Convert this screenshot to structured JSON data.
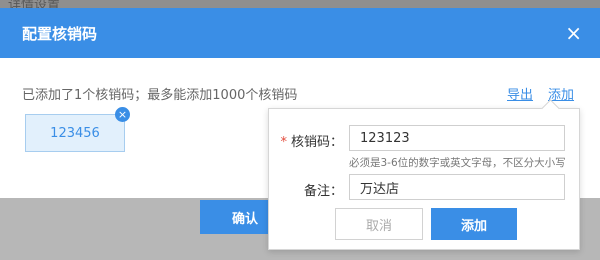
{
  "background": {
    "fragment": "详情设置"
  },
  "dialog": {
    "title": "配置核销码",
    "close_icon": "×",
    "info_text": "已添加了1个核销码；最多能添加1000个核销码",
    "export_label": "导出",
    "add_label": "添加",
    "confirm_label": "确认",
    "codes": [
      {
        "value": "123456"
      }
    ],
    "chip_remove_icon": "×"
  },
  "popover": {
    "code_label": "核销码：",
    "code_required_mark": "*",
    "code_value": "123123",
    "code_hint": "必须是3-6位的数字或英文字母，不区分大小写",
    "note_label": "备注：",
    "note_value": "万达店",
    "cancel_label": "取消",
    "add_label": "添加"
  },
  "colors": {
    "accent": "#3a8ee6",
    "required": "#e24a3b",
    "chip_bg": "#e2f0fc"
  }
}
